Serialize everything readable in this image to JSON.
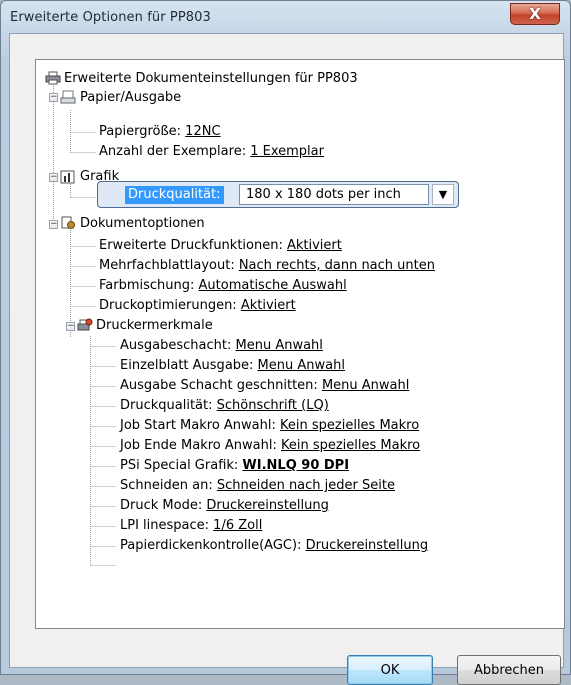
{
  "window": {
    "title": "Erweiterte Optionen für PP803",
    "close_glyph": "X"
  },
  "tree": {
    "root": "Erweiterte Dokumenteinstellungen für PP803",
    "papier": {
      "label": "Papier/Ausgabe",
      "items": [
        {
          "label": "Papiergröße: ",
          "value": "12NC"
        },
        {
          "label": "Anzahl der Exemplare: ",
          "value": "1 Exemplar"
        }
      ]
    },
    "grafik": {
      "label": "Grafik",
      "druckqualitaet_label": "Druckqualität:",
      "druckqualitaet_value": "180 x 180 dots per inch",
      "dropdown_glyph": "▼"
    },
    "dokument": {
      "label": "Dokumentoptionen",
      "items": [
        {
          "label": "Erweiterte Druckfunktionen: ",
          "value": "Aktiviert"
        },
        {
          "label": "Mehrfachblattlayout: ",
          "value": "Nach rechts, dann nach unten"
        },
        {
          "label": "Farbmischung: ",
          "value": "Automatische Auswahl"
        },
        {
          "label": "Druckoptimierungen: ",
          "value": "Aktiviert"
        }
      ]
    },
    "merkmale": {
      "label": "Druckermerkmale",
      "items": [
        {
          "label": "Ausgabeschacht: ",
          "value": "Menu Anwahl"
        },
        {
          "label": "Einzelblatt Ausgabe: ",
          "value": "Menu Anwahl"
        },
        {
          "label": "Ausgabe Schacht geschnitten: ",
          "value": "Menu Anwahl"
        },
        {
          "label": "Druckqualität: ",
          "value": "Schönschrift (LQ)"
        },
        {
          "label": "Job Start Makro Anwahl: ",
          "value": "Kein spezielles Makro"
        },
        {
          "label": "Job Ende Makro Anwahl: ",
          "value": "Kein spezielles Makro"
        },
        {
          "label": "PSi Special Grafik: ",
          "value": "WI.NLQ 90 DPI"
        },
        {
          "label": "Schneiden an: ",
          "value": "Schneiden nach jeder Seite"
        },
        {
          "label": "Druck Mode: ",
          "value": "Druckereinstellung"
        },
        {
          "label": "LPI linespace: ",
          "value": "1/6 Zoll"
        },
        {
          "label": "Papierdickenkontrolle(AGC): ",
          "value": "Druckereinstellung"
        }
      ]
    }
  },
  "buttons": {
    "ok": "OK",
    "cancel": "Abbrechen"
  },
  "colors": {
    "selection": "#3399ff",
    "close": "#c2432a"
  }
}
